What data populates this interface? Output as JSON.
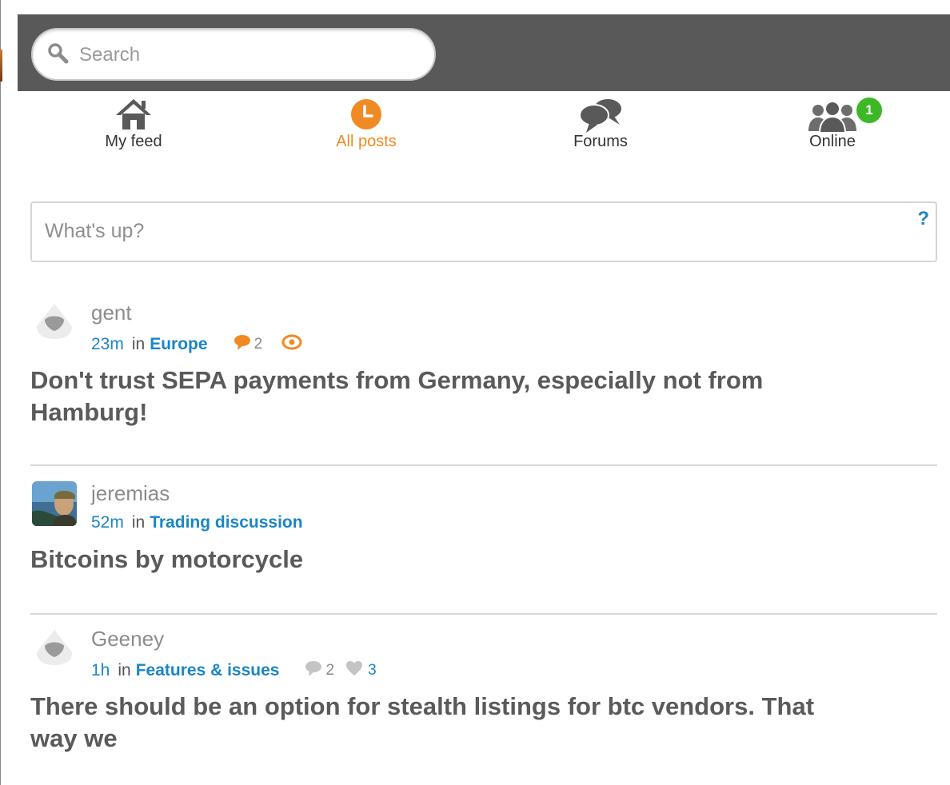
{
  "search": {
    "placeholder": "Search",
    "value": ""
  },
  "nav": {
    "items": [
      {
        "id": "my-feed",
        "label": "My feed",
        "icon": "home-icon",
        "active": false
      },
      {
        "id": "all-posts",
        "label": "All posts",
        "icon": "clock-icon",
        "active": true
      },
      {
        "id": "forums",
        "label": "Forums",
        "icon": "speech-bubbles-icon",
        "active": false
      },
      {
        "id": "online",
        "label": "Online",
        "icon": "users-icon",
        "active": false,
        "badge": "1"
      }
    ]
  },
  "composer": {
    "placeholder": "What's up?",
    "value": "",
    "help_label": "?"
  },
  "posts": [
    {
      "author": "gent",
      "avatar": "default-avatar",
      "time": "23m",
      "in_label": "in",
      "forum": "Europe",
      "comments": "2",
      "watched": true,
      "title": "Don't trust SEPA payments from Germany, especially not from Hamburg!"
    },
    {
      "author": "jeremias",
      "avatar": "photo-avatar",
      "time": "52m",
      "in_label": "in",
      "forum": "Trading discussion",
      "title": "Bitcoins by motorcycle"
    },
    {
      "author": "Geeney",
      "avatar": "default-avatar",
      "time": "1h",
      "in_label": "in",
      "forum": "Features & issues",
      "comments": "2",
      "likes": "3",
      "title": "There should be an option for stealth listings for btc vendors. That way we"
    }
  ],
  "colors": {
    "header_bg": "#595959",
    "accent_orange": "#f08a24",
    "link_blue": "#1a85c6",
    "badge_green": "#3cb826",
    "title_gray": "#5a5a5a"
  }
}
